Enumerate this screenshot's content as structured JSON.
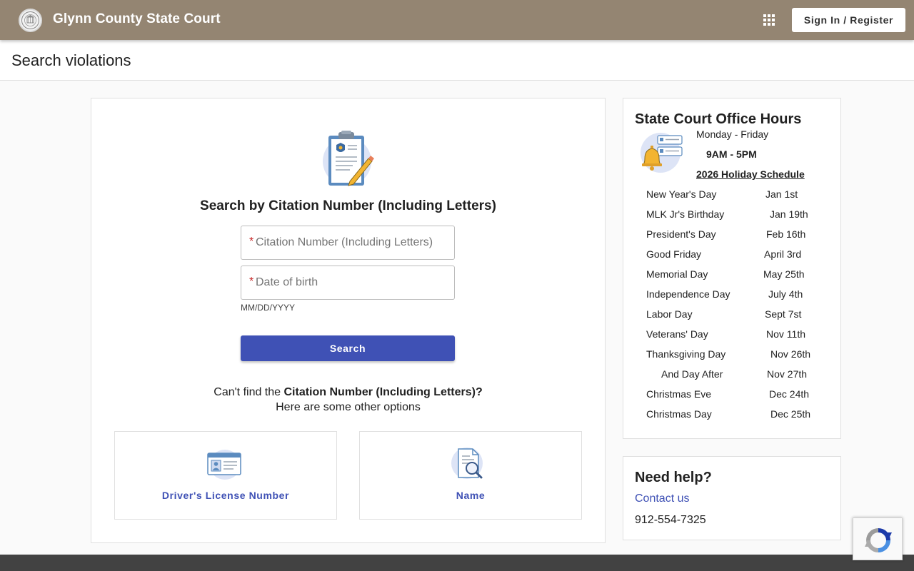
{
  "header": {
    "title": "Glynn County State Court",
    "signin_label": "Sign In / Register"
  },
  "page": {
    "title": "Search violations"
  },
  "search": {
    "heading": "Search by Citation Number (Including Letters)",
    "citation_placeholder": "Citation Number (Including Letters)",
    "dob_placeholder": "Date of birth",
    "required_mark": "*",
    "dob_hint": "MM/DD/YYYY",
    "button_label": "Search",
    "cant_find_prefix": "Can't find the ",
    "cant_find_bold": "Citation Number (Including Letters)?",
    "cant_find_line2": "Here are some other options",
    "options": [
      {
        "label": "Driver's License Number",
        "icon": "id-card-icon"
      },
      {
        "label": "Name",
        "icon": "document-search-icon"
      }
    ]
  },
  "hours": {
    "title": "State Court Office Hours",
    "days": "Monday - Friday",
    "time": "9AM - 5PM",
    "holiday_link": "2026 Holiday Schedule",
    "holidays": [
      {
        "name": "New Year's Day",
        "date": "Jan 1st"
      },
      {
        "name": "MLK Jr's Birthday",
        "date": "Jan 19th"
      },
      {
        "name": "President's Day",
        "date": "Feb 16th"
      },
      {
        "name": "Good Friday",
        "date": "April 3rd"
      },
      {
        "name": "Memorial Day",
        "date": "May 25th"
      },
      {
        "name": "Independence Day",
        "date": "July 4th"
      },
      {
        "name": "Labor Day",
        "date": "Sept 7st"
      },
      {
        "name": "Veterans' Day",
        "date": "Nov 11th"
      },
      {
        "name": "Thanksgiving Day",
        "date": "Nov 26th"
      },
      {
        "name": "And Day After",
        "date": "Nov 27th"
      },
      {
        "name": "Christmas Eve",
        "date": "Dec 24th"
      },
      {
        "name": "Christmas Day",
        "date": "Dec 25th"
      }
    ]
  },
  "help": {
    "title": "Need help?",
    "contact_label": "Contact us",
    "phone": "912-554-7325"
  },
  "colors": {
    "header_bg": "#948572",
    "primary": "#3f51b5",
    "required": "#c62828"
  }
}
